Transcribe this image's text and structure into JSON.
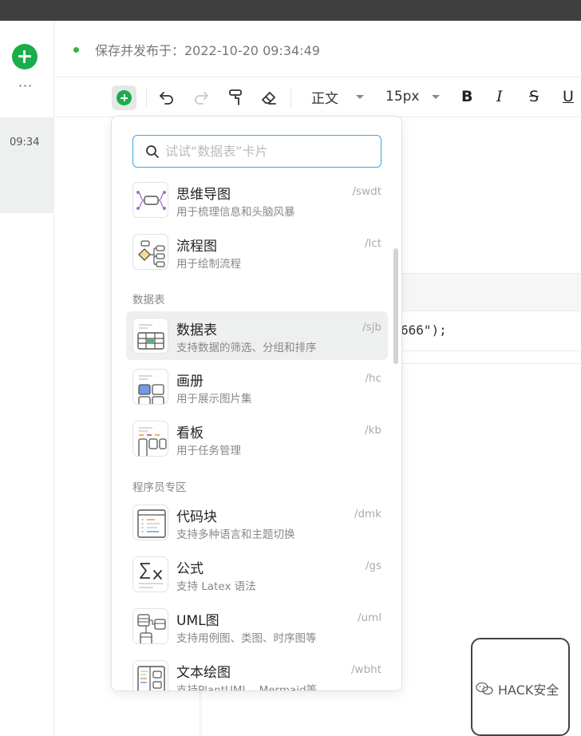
{
  "rail": {
    "time": "09:34",
    "more": "···"
  },
  "status": {
    "text": "保存并发布于：2022-10-20 09:34:49"
  },
  "toolbar": {
    "style_select": "正文",
    "size_select": "15px",
    "bold": "B",
    "italic": "I",
    "strike": "S",
    "underline": "U"
  },
  "editor": {
    "code_text": "666\");"
  },
  "menu": {
    "search_placeholder": "试试“数据表”卡片",
    "items_top": [
      {
        "title": "思维导图",
        "desc": "用于梳理信息和头脑风暴",
        "shortcut": "/swdt"
      },
      {
        "title": "流程图",
        "desc": "用于绘制流程",
        "shortcut": "/lct"
      }
    ],
    "section_data": "数据表",
    "items_data": [
      {
        "title": "数据表",
        "desc": "支持数据的筛选、分组和排序",
        "shortcut": "/sjb"
      },
      {
        "title": "画册",
        "desc": "用于展示图片集",
        "shortcut": "/hc"
      },
      {
        "title": "看板",
        "desc": "用于任务管理",
        "shortcut": "/kb"
      }
    ],
    "section_dev": "程序员专区",
    "items_dev": [
      {
        "title": "代码块",
        "desc": "支持多种语言和主题切换",
        "shortcut": "/dmk"
      },
      {
        "title": "公式",
        "desc": "支持 Latex 语法",
        "shortcut": "/gs"
      },
      {
        "title": "UML图",
        "desc": "支持用例图、类图、时序图等",
        "shortcut": "/uml"
      },
      {
        "title": "文本绘图",
        "desc": "支持PlantUML、Mermaid等",
        "shortcut": "/wbht"
      }
    ]
  },
  "watermark": {
    "text": "HACK安全"
  },
  "colors": {
    "accent_green": "#1aad4b",
    "search_border": "#3aa6ea"
  }
}
